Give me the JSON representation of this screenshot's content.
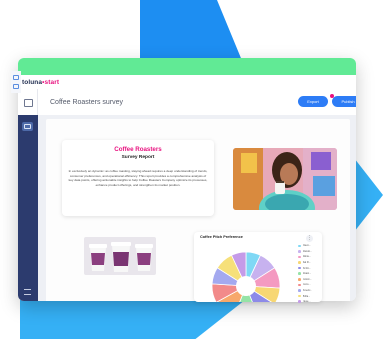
{
  "app": {
    "logo_main": "toluna",
    "logo_accent": "start"
  },
  "header": {
    "title": "Coffee Roasters survey",
    "export_label": "Export",
    "publish_label": "Publish"
  },
  "report": {
    "title": "Coffee Roasters",
    "subtitle": "Survey Report",
    "body": "In exclusively an dynamic: as coffee roasting, staying ahead requires a deep understanding of trends, consumer preferences, and operational efficiency. This report provides a comprehensive analysis of key data points, offering actionable insights to help Coffee Roasters Company optimize its processes, enhance product offerings, and strengthen its market position."
  },
  "pie": {
    "title": "Coffee Pitch Preference",
    "menu_symbol": "⋮"
  },
  "chart_data": {
    "type": "pie",
    "title": "Coffee Pitch Preference",
    "categories": [
      "Flavo...",
      "Rando...",
      "Winte...",
      "Sal R...",
      "At Ro...",
      "Roast...",
      "Colom...",
      "Coco...",
      "Americ...",
      "Brilla...",
      "Nese..."
    ],
    "values": [
      7,
      9,
      10,
      8,
      10,
      12,
      11,
      9,
      8,
      9,
      7
    ],
    "colors": [
      "#7fd8f5",
      "#c7b2ef",
      "#f49ac1",
      "#f7d774",
      "#8d8ae8",
      "#95e3a6",
      "#f7a86b",
      "#f28a8a",
      "#a4a9ef",
      "#f6e07a",
      "#c59be8"
    ],
    "legend_placement": "right"
  }
}
